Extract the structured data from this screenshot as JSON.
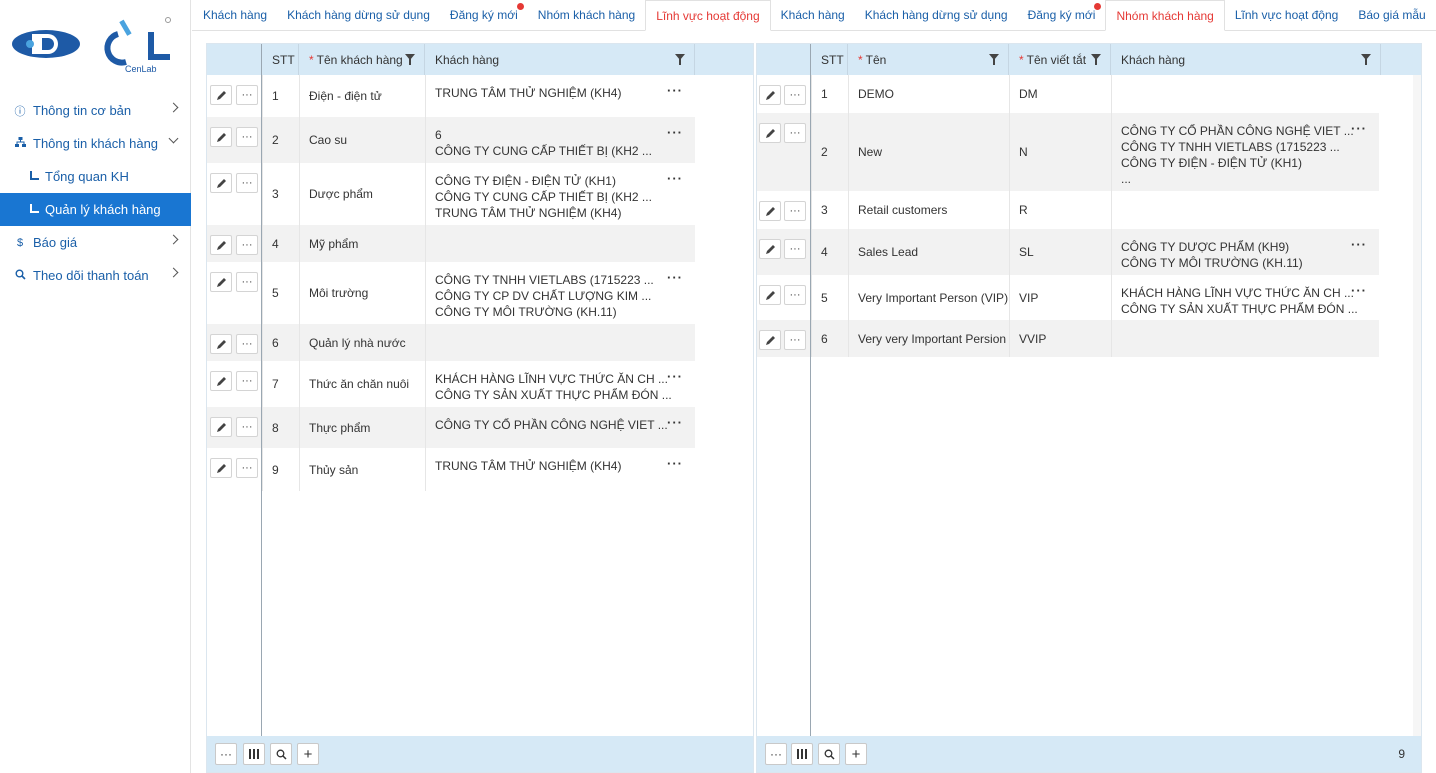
{
  "brand": {
    "logo_text": "CenLab",
    "accent": "#1976d2",
    "alert": "#e53935"
  },
  "sidebar": {
    "items": [
      {
        "label": "Thông tin cơ bản",
        "icon": "info-icon"
      },
      {
        "label": "Thông tin khách hàng",
        "icon": "hierarchy-icon"
      },
      {
        "label": "Tổng quan KH",
        "icon": "corner-icon"
      },
      {
        "label": "Quản lý khách hàng",
        "icon": "corner-icon"
      },
      {
        "label": "Báo giá",
        "icon": "dollar-icon"
      },
      {
        "label": "Theo dõi thanh toán",
        "icon": "search-icon"
      }
    ]
  },
  "tabs": [
    {
      "label": "Khách hàng"
    },
    {
      "label": "Khách hàng dừng sử dụng"
    },
    {
      "label": "Đăng ký mới"
    },
    {
      "label": "Nhóm khách hàng"
    },
    {
      "label": "Lĩnh vực hoạt động"
    },
    {
      "label": "Khách hàng"
    },
    {
      "label": "Khách hàng dừng sử dụng"
    },
    {
      "label": "Đăng ký mới"
    },
    {
      "label": "Nhóm khách hàng"
    },
    {
      "label": "Lĩnh vực hoạt động"
    },
    {
      "label": "Báo giá mẫu"
    }
  ],
  "left_grid": {
    "columns": {
      "stt": "STT",
      "name": "Tên khách hàng",
      "customers": "Khách hàng"
    },
    "rows": [
      {
        "stt": "1",
        "name": "Điện - điện tử",
        "customers": [
          "TRUNG TÂM THỬ NGHIỆM (KH4)"
        ]
      },
      {
        "stt": "2",
        "name": "Cao su",
        "customers": [
          "6",
          "CÔNG TY CUNG CẤP THIẾT BỊ (KH2 ..."
        ]
      },
      {
        "stt": "3",
        "name": "Dược phẩm",
        "customers": [
          "CÔNG TY ĐIỆN - ĐIỆN TỬ (KH1)",
          "CÔNG TY CUNG CẤP THIẾT BỊ (KH2 ...",
          "TRUNG TÂM THỬ NGHIỆM (KH4)"
        ]
      },
      {
        "stt": "4",
        "name": "Mỹ phẩm",
        "customers": []
      },
      {
        "stt": "5",
        "name": "Môi trường",
        "customers": [
          "CÔNG TY TNHH VIETLABS (1715223 ...",
          "CÔNG TY CP DV CHẤT LƯỢNG KIM ...",
          "CÔNG TY MÔI TRƯỜNG (KH.11)"
        ]
      },
      {
        "stt": "6",
        "name": "Quản lý nhà nước",
        "customers": []
      },
      {
        "stt": "7",
        "name": "Thức ăn chăn nuôi",
        "customers": [
          "KHÁCH HÀNG LĨNH VỰC THỨC ĂN CH ...",
          "CÔNG TY SẢN XUẤT THỰC PHẨM ĐÓN ..."
        ]
      },
      {
        "stt": "8",
        "name": "Thực phẩm",
        "customers": [
          "CÔNG TY CỔ PHẦN CÔNG NGHỆ VIET ..."
        ]
      },
      {
        "stt": "9",
        "name": "Thủy sản",
        "customers": [
          "TRUNG TÂM THỬ NGHIỆM (KH4)"
        ]
      }
    ]
  },
  "right_grid": {
    "columns": {
      "stt": "STT",
      "name": "Tên",
      "short": "Tên viết tắt",
      "customers": "Khách hàng"
    },
    "rows": [
      {
        "stt": "1",
        "name": "DEMO",
        "short": "DM",
        "customers": []
      },
      {
        "stt": "2",
        "name": "New",
        "short": "N",
        "customers": [
          "CÔNG TY CỔ PHẦN CÔNG NGHỆ VIET ...",
          "CÔNG TY TNHH VIETLABS (1715223 ...",
          "CÔNG TY ĐIỆN - ĐIỆN TỬ (KH1)",
          "..."
        ]
      },
      {
        "stt": "3",
        "name": "Retail customers",
        "short": "R",
        "customers": []
      },
      {
        "stt": "4",
        "name": "Sales Lead",
        "short": "SL",
        "customers": [
          "CÔNG TY DƯỢC PHẨM (KH9)",
          "CÔNG TY MÔI TRƯỜNG (KH.11)"
        ]
      },
      {
        "stt": "5",
        "name": "Very Important Person (VIP)",
        "short": "VIP",
        "customers": [
          "KHÁCH HÀNG LĨNH VỰC THỨC ĂN CH ...",
          "CÔNG TY SẢN XUẤT THỰC PHẨM ĐÓN ..."
        ]
      },
      {
        "stt": "6",
        "name": "Very very Important Persion",
        "short": "VVIP",
        "customers": []
      }
    ],
    "count": "9"
  }
}
